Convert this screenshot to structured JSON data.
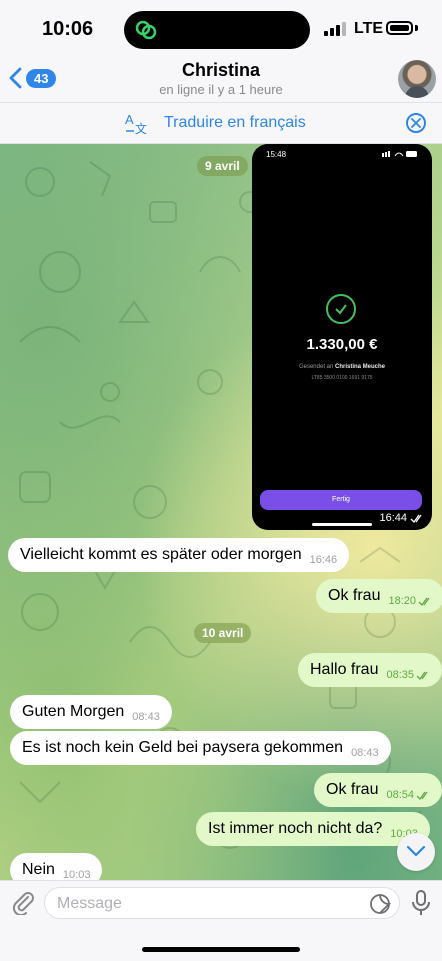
{
  "status_bar": {
    "time": "10:06",
    "network": "LTE"
  },
  "header": {
    "back_badge": "43",
    "contact_name": "Christina",
    "contact_status": "en ligne il y a 1 heure"
  },
  "translate_bar": {
    "label": "Traduire en français"
  },
  "chat": {
    "photo_message": {
      "date_chip": "9 avril",
      "screenshot_time": "15:48",
      "amount": "1.330,00 €",
      "sent_to_prefix": "Gesendet an",
      "sent_to_name": "Christina Meuche",
      "iban_line": "LT85 3500 0100 1691 9175",
      "button_label": "Fertig",
      "time": "16:44"
    },
    "messages": [
      {
        "dir": "in",
        "text": "Vielleicht kommt es später oder morgen",
        "time": "16:46"
      },
      {
        "dir": "out",
        "text": "Ok frau",
        "time": "18:20"
      },
      {
        "type": "date",
        "text": "10 avril"
      },
      {
        "dir": "out",
        "text": "Hallo frau",
        "time": "08:35"
      },
      {
        "dir": "in",
        "text": "Guten Morgen",
        "time": "08:43"
      },
      {
        "dir": "in",
        "text": "Es ist noch kein Geld bei paysera gekommen",
        "time": "08:43"
      },
      {
        "dir": "out",
        "text": "Ok frau",
        "time": "08:54"
      },
      {
        "dir": "out",
        "text": "Ist immer noch nicht da?",
        "time": "10:03"
      },
      {
        "dir": "in",
        "text": "Nein",
        "time": "10:03"
      }
    ]
  },
  "input": {
    "placeholder": "Message"
  },
  "colors": {
    "accent": "#2f86e6",
    "outgoing_bubble": "#e2f8c9",
    "incoming_bubble": "#ffffff",
    "read_check": "#5faa45"
  }
}
